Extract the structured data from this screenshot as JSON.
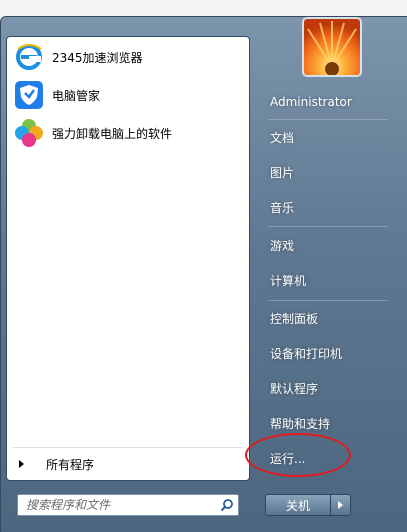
{
  "left_pane": {
    "programs": [
      {
        "label": "2345加速浏览器",
        "icon": "ie-browser-icon"
      },
      {
        "label": "电脑管家",
        "icon": "pc-manager-shield-icon"
      },
      {
        "label": "强力卸载电脑上的软件",
        "icon": "uninstaller-clover-icon"
      }
    ],
    "all_programs_label": "所有程序"
  },
  "search": {
    "placeholder": "搜索程序和文件",
    "icon": "magnifier-icon"
  },
  "user": {
    "picture": "flower-user-picture",
    "name": "Administrator"
  },
  "right_pane": {
    "items": [
      "文档",
      "图片",
      "音乐",
      "游戏",
      "计算机",
      "控制面板",
      "设备和打印机",
      "默认程序",
      "帮助和支持",
      "运行..."
    ]
  },
  "shutdown": {
    "label": "关机",
    "arrow_icon": "right-arrow-icon"
  },
  "annotation": {
    "highlighted_item": "运行...",
    "color": "#e11b1b"
  }
}
